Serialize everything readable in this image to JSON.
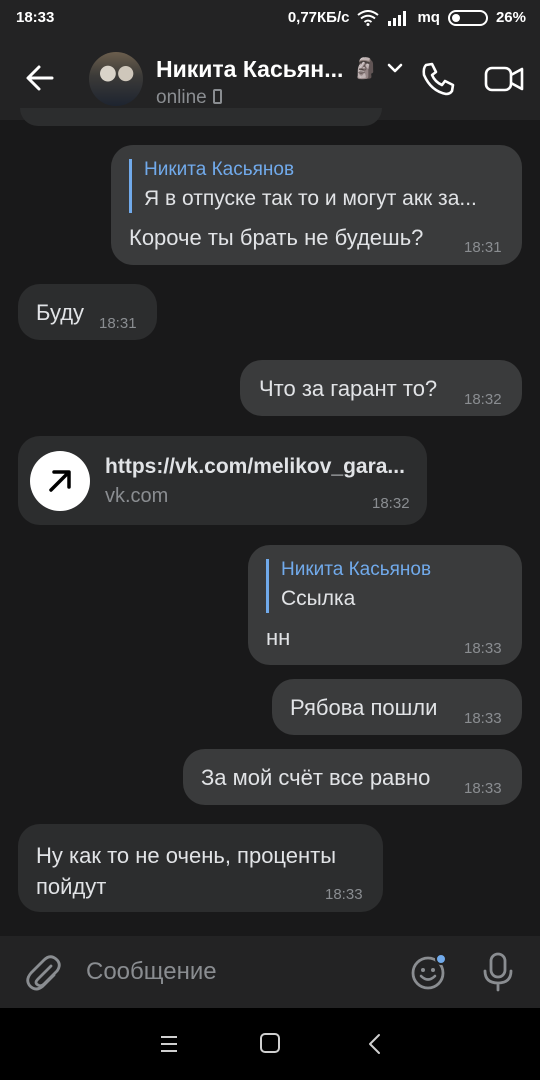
{
  "status_bar": {
    "time": "18:33",
    "network_speed": "0,77КБ/с",
    "carrier": "mq",
    "battery": "26%",
    "battery_level": 0.26
  },
  "header": {
    "contact_name": "Никита Касьян...",
    "name_emoji": "🗿",
    "status": "online"
  },
  "messages": [
    {
      "direction": "out",
      "reply_author": "Никита Касьянов",
      "reply_text": "Я в отпуске так то и могут акк за...",
      "text": "Короче ты брать не будешь?",
      "time": "18:31"
    },
    {
      "direction": "in",
      "text": "Буду",
      "time": "18:31"
    },
    {
      "direction": "out",
      "text": "Что за гарант то?",
      "time": "18:32"
    },
    {
      "direction": "in",
      "link_url": "https://vk.com/melikov_gara...",
      "link_domain": "vk.com",
      "time": "18:32"
    },
    {
      "direction": "out",
      "reply_author": "Никита Касьянов",
      "reply_text": "Ссылка",
      "text": "нн",
      "time": "18:33"
    },
    {
      "direction": "out",
      "text": "Рябова пошли",
      "time": "18:33"
    },
    {
      "direction": "out",
      "text": "За мой счёт все равно",
      "time": "18:33"
    },
    {
      "direction": "in",
      "text": "Ну как то не очень, проценты пойдут",
      "time": "18:33"
    }
  ],
  "composer": {
    "placeholder": "Сообщение"
  },
  "icons": {
    "back": "arrow-left-icon",
    "call": "phone-icon",
    "video": "video-camera-icon",
    "attach": "paperclip-icon",
    "emoji": "smiley-icon",
    "mic": "microphone-icon"
  },
  "colors": {
    "accent": "#71aaeb",
    "background": "#19191a",
    "bubble_in": "#2c2d2e",
    "bubble_out": "#3a3b3c"
  }
}
